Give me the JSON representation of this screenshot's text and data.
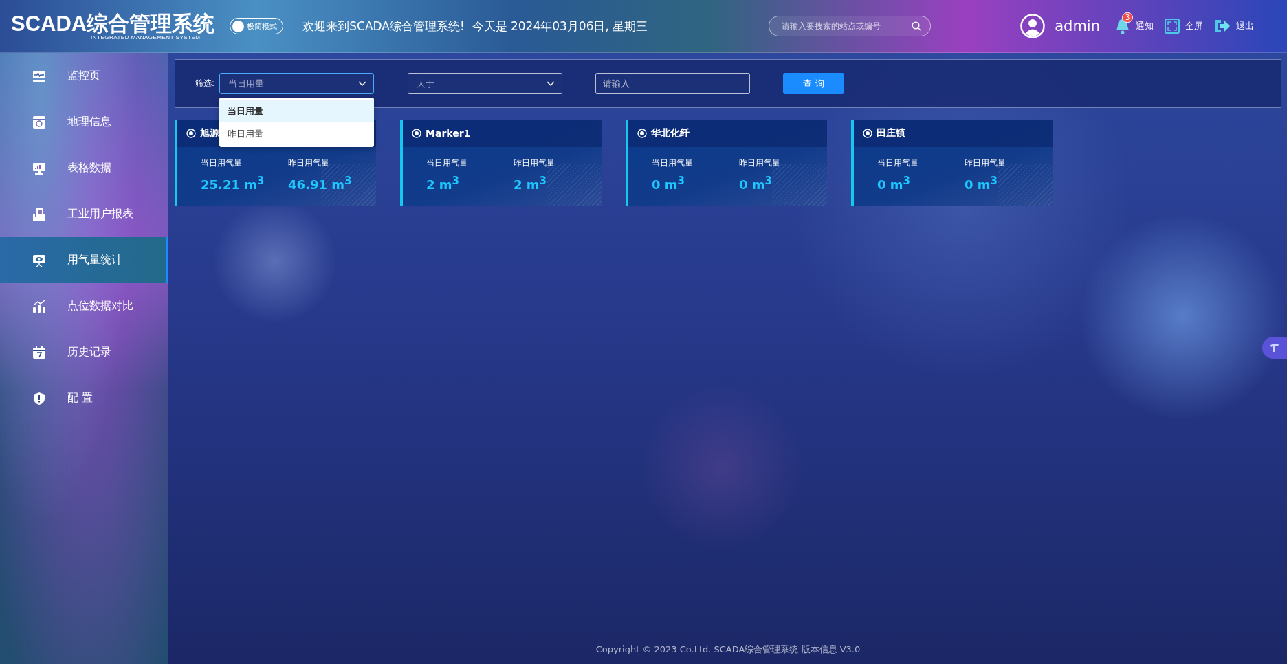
{
  "header": {
    "logo": "SCADA综合管理系统",
    "logo_subtitle": "INTEGRATED MANAGEMENT SYSTEM",
    "mode_toggle": {
      "label": "极简模式",
      "on": false
    },
    "welcome": "欢迎来到SCADA综合管理系统!  今天是 2024年03月06日, 星期三",
    "search": {
      "placeholder": "请输入要搜索的站点或编号"
    },
    "user": "admin",
    "notifications": {
      "label": "通知",
      "badge": "3"
    },
    "fullscreen": "全屏",
    "logout": "退出"
  },
  "sidebar": {
    "items": [
      {
        "label": "监控页",
        "selected": false
      },
      {
        "label": "地理信息",
        "selected": false
      },
      {
        "label": "表格数据",
        "selected": false
      },
      {
        "label": "工业用户报表",
        "selected": false
      },
      {
        "label": "用气量统计",
        "selected": true
      },
      {
        "label": "点位数据对比",
        "selected": false
      },
      {
        "label": "历史记录",
        "selected": false
      },
      {
        "label": "配 置",
        "selected": false
      }
    ]
  },
  "filter": {
    "label": "筛选:",
    "field": {
      "value": "当日用量",
      "expanded": true,
      "options": [
        {
          "label": "当日用量",
          "selected": true
        },
        {
          "label": "昨日用量",
          "selected": false
        }
      ]
    },
    "comparison": {
      "value": "大于"
    },
    "input": {
      "placeholder": "请输入"
    },
    "button": "查 询"
  },
  "cards": [
    {
      "title": "旭源",
      "metrics": [
        {
          "label": "当日用气量",
          "value": "25.21 m$^{3}$"
        },
        {
          "label": "昨日用气量",
          "value": "46.91 m$^{3}$"
        }
      ]
    },
    {
      "title": "Marker1",
      "metrics": [
        {
          "label": "当日用气量",
          "value": "2 m$^{3}$"
        },
        {
          "label": "昨日用气量",
          "value": "2 m$^{3}$"
        }
      ]
    },
    {
      "title": "华北化纤",
      "metrics": [
        {
          "label": "当日用气量",
          "value": "0 m$^{3}$"
        },
        {
          "label": "昨日用气量",
          "value": "0 m$^{3}$"
        }
      ]
    },
    {
      "title": "田庄镇",
      "metrics": [
        {
          "label": "当日用气量",
          "value": "0 m$^{3}$"
        },
        {
          "label": "昨日用气量",
          "value": "0 m$^{3}$"
        }
      ]
    }
  ],
  "footer": "Copyright © 2023 Co.Ltd. SCADA综合管理系统 版本信息 V3.0"
}
